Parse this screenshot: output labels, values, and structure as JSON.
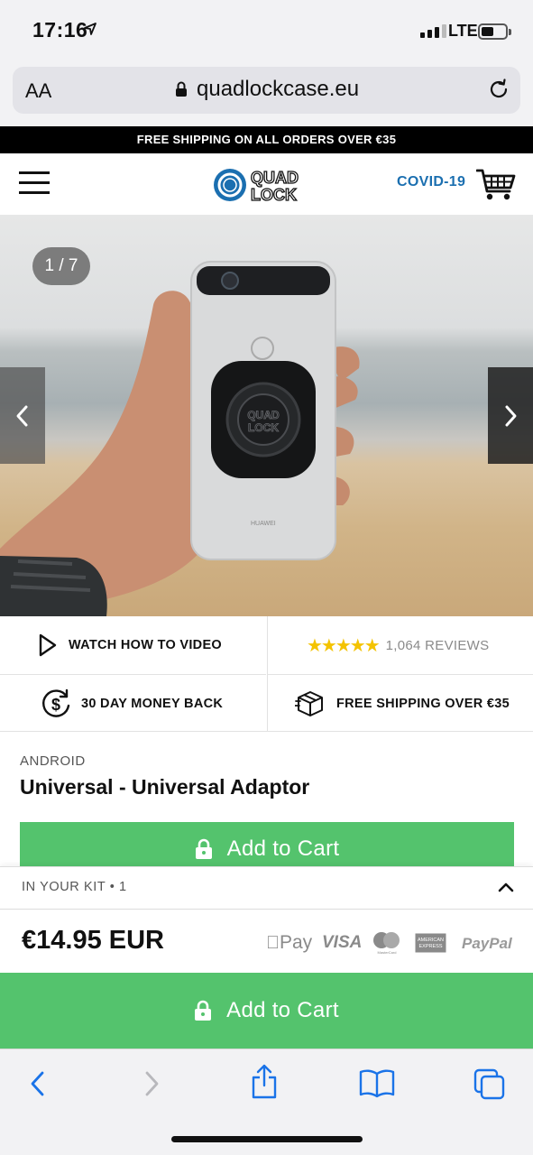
{
  "status_bar": {
    "time": "17:16",
    "network": "LTE"
  },
  "browser": {
    "text_size_label": "AA",
    "url": "quadlockcase.eu"
  },
  "promo": {
    "text": "FREE SHIPPING ON ALL ORDERS OVER €35"
  },
  "header": {
    "logo_line1": "QUAD",
    "logo_line2": "LOCK",
    "covid_link": "COVID-19"
  },
  "gallery": {
    "counter": "1 / 7",
    "current": 1,
    "total": 7,
    "image_text": {
      "mount_logo_line1": "QUAD",
      "mount_logo_line2": "LOCK",
      "phone_brand": "HUAWEI"
    }
  },
  "info": {
    "video": "WATCH HOW TO VIDEO",
    "rating": 4.5,
    "reviews": "1,064 REVIEWS",
    "money_back": "30 DAY MONEY BACK",
    "shipping": "FREE SHIPPING OVER €35"
  },
  "product": {
    "category": "ANDROID",
    "title": "Universal - Universal Adaptor",
    "add_to_cart": "Add to Cart"
  },
  "kit": {
    "label": "IN YOUR KIT • 1"
  },
  "price": {
    "amount": "€14.95 EUR"
  },
  "payments": {
    "apple_pay": "Pay",
    "visa": "VISA",
    "mastercard": "MasterCard",
    "amex_line1": "AMERICAN",
    "amex_line2": "EXPRESS",
    "paypal": "PayPal"
  },
  "sticky_cart": {
    "label": "Add to Cart"
  },
  "colors": {
    "accent_green": "#54c36d",
    "covid_blue": "#1b6fb0",
    "logo_blue": "#1b6fb0",
    "star_yellow": "#f4c300"
  }
}
